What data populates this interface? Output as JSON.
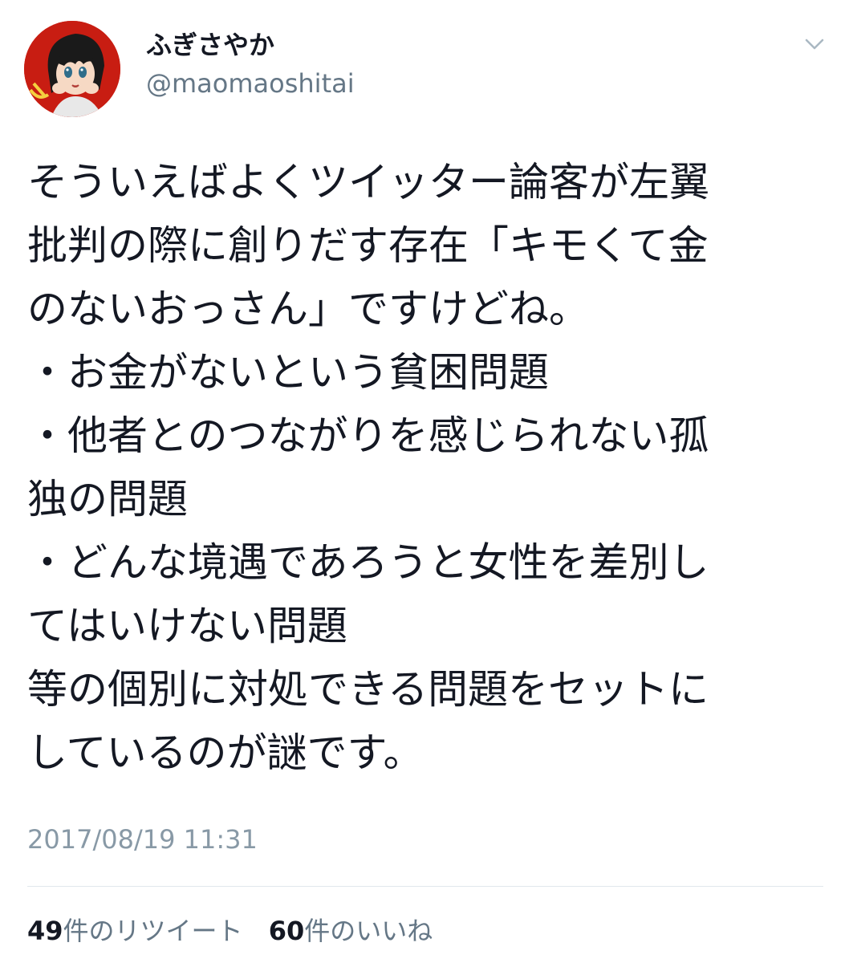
{
  "user": {
    "display_name": "ふぎさやか",
    "handle": "@maomaoshitai",
    "avatar_icon": "anime-character-avatar-icon"
  },
  "menu": {
    "icon": "chevron-down-icon"
  },
  "tweet": {
    "text": "そういえばよくツイッター論客が左翼\n批判の際に創りだす存在「キモくて金\nのないおっさん」ですけどね。\n・お金がないという貧困問題\n・他者とのつながりを感じられない孤\n独の問題\n・どんな境遇であろうと女性を差別し\nてはいけない問題\n等の個別に対処できる問題をセットに\nしているのが謎です。",
    "timestamp": "2017/08/19 11:31"
  },
  "stats": {
    "retweets_count": "49",
    "retweets_label": "件のリツイート",
    "likes_count": "60",
    "likes_label": "件のいいね"
  },
  "colors": {
    "text": "#141823",
    "secondary": "#657786",
    "timestamp": "#8899a6",
    "divider": "#e1e8ed",
    "avatar_bg": "#c81d12"
  }
}
